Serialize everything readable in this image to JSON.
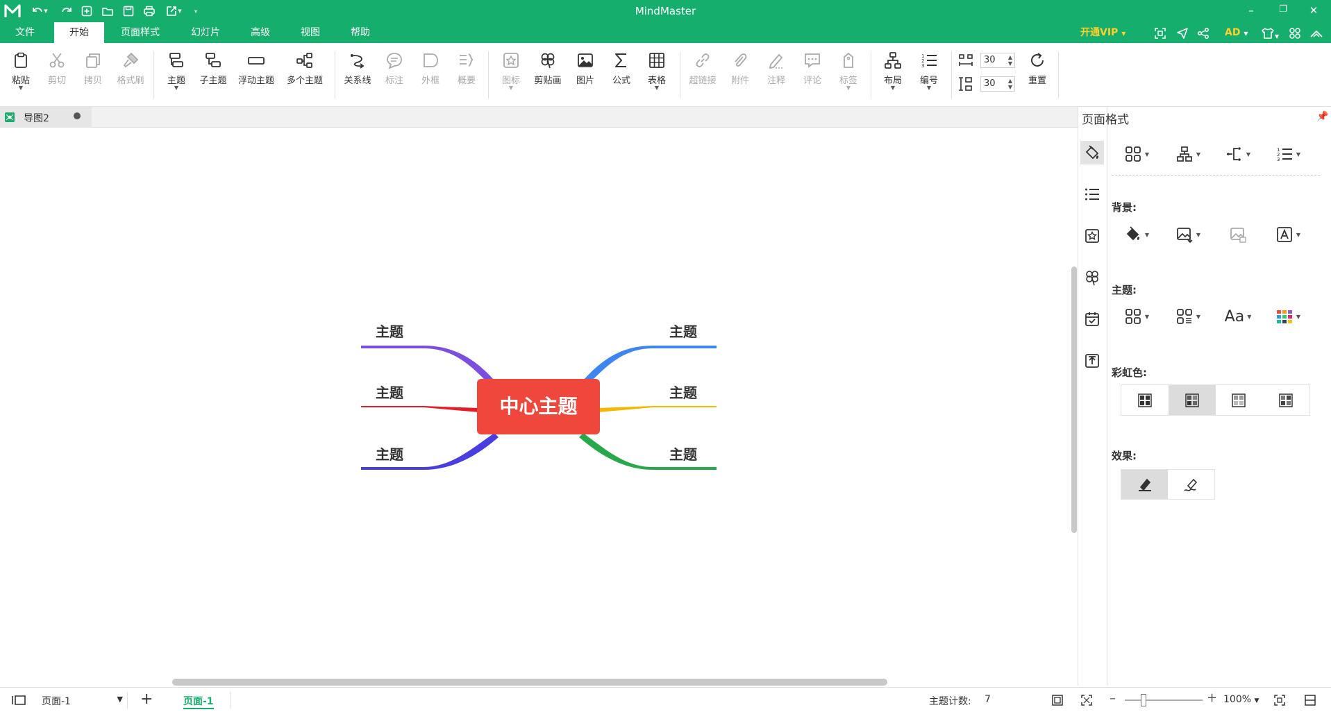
{
  "app": {
    "title": "MindMaster"
  },
  "menu": {
    "items": [
      "文件",
      "开始",
      "页面样式",
      "幻灯片",
      "高级",
      "视图",
      "帮助"
    ],
    "active": "开始",
    "vip": "开通VIP",
    "user": "AD"
  },
  "ribbon": {
    "paste": "粘贴",
    "cut": "剪切",
    "copy": "拷贝",
    "format_painter": "格式刷",
    "topic": "主题",
    "subtopic": "子主题",
    "floating_topic": "浮动主题",
    "multiple_topics": "多个主题",
    "relationship": "关系线",
    "callout": "标注",
    "boundary": "外框",
    "summary": "概要",
    "icon": "图标",
    "clipart": "剪贴画",
    "image": "图片",
    "formula": "公式",
    "table": "表格",
    "hyperlink": "超链接",
    "attachment": "附件",
    "note": "注释",
    "comment": "评论",
    "tag": "标签",
    "layout": "布局",
    "numbering": "编号",
    "h_spacing": "30",
    "v_spacing": "30",
    "reset": "重置"
  },
  "tabs": {
    "document": "导图2"
  },
  "mindmap": {
    "central": "中心主题",
    "topics": [
      "主题",
      "主题",
      "主题",
      "主题",
      "主题",
      "主题"
    ],
    "branch_colors": [
      "#7b4ee0",
      "#e51c23",
      "#4a3de0",
      "#3d86f0",
      "#f5b800",
      "#29a84b"
    ],
    "central_color": "#f0473c"
  },
  "panel": {
    "title": "页面格式",
    "background_label": "背景:",
    "theme_label": "主题:",
    "rainbow_label": "彩虹色:",
    "effect_label": "效果:"
  },
  "status": {
    "page_select": "页面-1",
    "page_tab": "页面-1",
    "topic_count_label": "主题计数:",
    "topic_count": "7",
    "zoom": "100%"
  },
  "colors": {
    "brand": "#15ae6c",
    "vip": "#ffd02b"
  }
}
